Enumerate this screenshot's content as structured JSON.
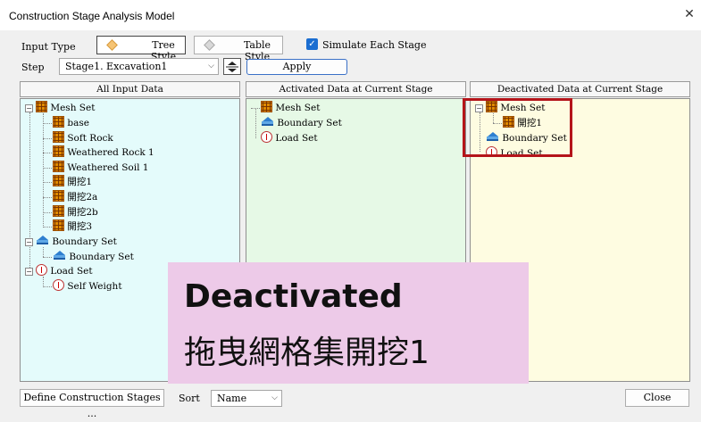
{
  "window": {
    "title": "Construction Stage Analysis Model",
    "close_glyph": "✕"
  },
  "input_type": {
    "label": "Input Type",
    "tree_style": "Tree Style",
    "table_style": "Table Style",
    "simulate_label": "Simulate Each Stage",
    "simulate_checked": true
  },
  "step": {
    "label": "Step",
    "value": "Stage1. Excavation1",
    "apply": "Apply"
  },
  "panels": {
    "all_input": {
      "header": "All Input Data",
      "mesh_set": "Mesh Set",
      "mesh_items": [
        "base",
        "Soft Rock",
        "Weathered Rock 1",
        "Weathered Soil 1",
        "開挖1",
        "開挖2a",
        "開挖2b",
        "開挖3"
      ],
      "boundary_set": "Boundary Set",
      "boundary_items": [
        "Boundary Set"
      ],
      "load_set": "Load Set",
      "load_items": [
        "Self Weight"
      ]
    },
    "activated": {
      "header": "Activated Data at Current Stage",
      "mesh_set": "Mesh Set",
      "boundary_set": "Boundary Set",
      "load_set": "Load Set"
    },
    "deactivated": {
      "header": "Deactivated Data at Current Stage",
      "mesh_set": "Mesh Set",
      "mesh_items": [
        "開挖1"
      ],
      "boundary_set": "Boundary Set",
      "load_set": "Load Set"
    }
  },
  "overlay": {
    "line1": "Deactivated",
    "line2": "拖曳網格集開挖1"
  },
  "footer": {
    "define_button": "Define Construction Stages ...",
    "sort_label": "Sort",
    "sort_value": "Name",
    "close_button": "Close"
  },
  "colors": {
    "all_panel_bg": "#e4fbfb",
    "activated_bg": "#e6f9e6",
    "deactivated_bg": "#fefce1",
    "highlight": "#b4141a",
    "overlay_bg": "#edcae8"
  }
}
